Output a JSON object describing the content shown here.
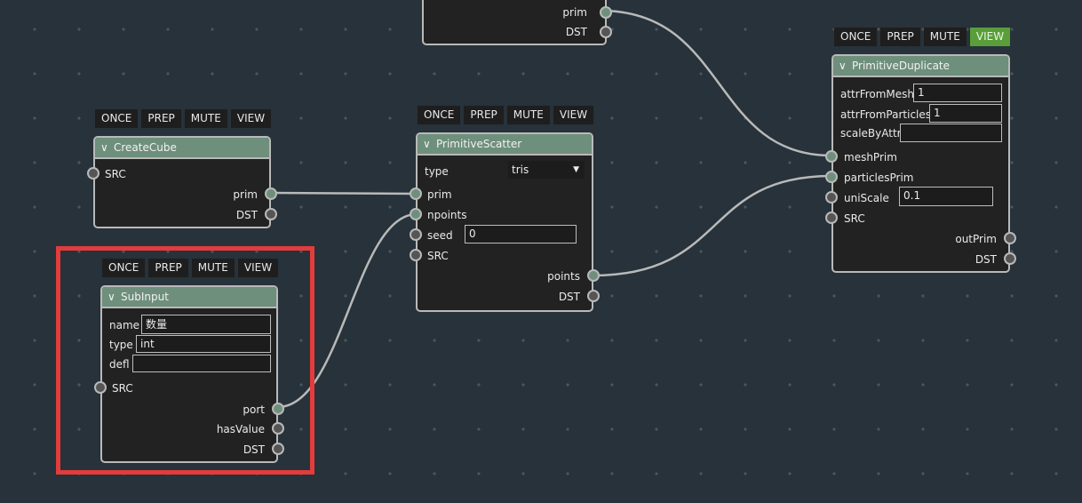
{
  "toolbar_labels": {
    "once": "ONCE",
    "prep": "PREP",
    "mute": "MUTE",
    "view": "VIEW"
  },
  "colors": {
    "background": "#27323a",
    "node_header": "#6e8f7c",
    "socket_connected": "#6e8f7c",
    "view_active": "#5a9e3a",
    "highlight": "#e23c3c"
  },
  "top_node": {
    "outputs": {
      "prim": "prim",
      "dst": "DST"
    }
  },
  "create_cube": {
    "title": "CreateCube",
    "inputs": {
      "src": "SRC"
    },
    "outputs": {
      "prim": "prim",
      "dst": "DST"
    }
  },
  "sub_input": {
    "title": "SubInput",
    "params": {
      "name_label": "name",
      "name_value": "数量",
      "type_label": "type",
      "type_value": "int",
      "defl_label": "defl",
      "defl_value": ""
    },
    "inputs": {
      "src": "SRC"
    },
    "outputs": {
      "port": "port",
      "has_value": "hasValue",
      "dst": "DST"
    }
  },
  "primitive_scatter": {
    "title": "PrimitiveScatter",
    "params": {
      "type_label": "type",
      "type_value": "tris"
    },
    "inputs": {
      "prim": "prim",
      "npoints": "npoints",
      "seed": "seed",
      "seed_value": "0",
      "src": "SRC"
    },
    "outputs": {
      "points": "points",
      "dst": "DST"
    }
  },
  "primitive_duplicate": {
    "title": "PrimitiveDuplicate",
    "view_active": true,
    "params": {
      "attr_from_mesh_label": "attrFromMesh",
      "attr_from_mesh_value": "1",
      "attr_from_particles_label": "attrFromParticles",
      "attr_from_particles_value": "1",
      "scale_by_attr_label": "scaleByAttr",
      "scale_by_attr_value": ""
    },
    "inputs": {
      "mesh_prim": "meshPrim",
      "particles_prim": "particlesPrim",
      "uni_scale": "uniScale",
      "uni_scale_value": "0.1",
      "src": "SRC"
    },
    "outputs": {
      "out_prim": "outPrim",
      "dst": "DST"
    }
  }
}
